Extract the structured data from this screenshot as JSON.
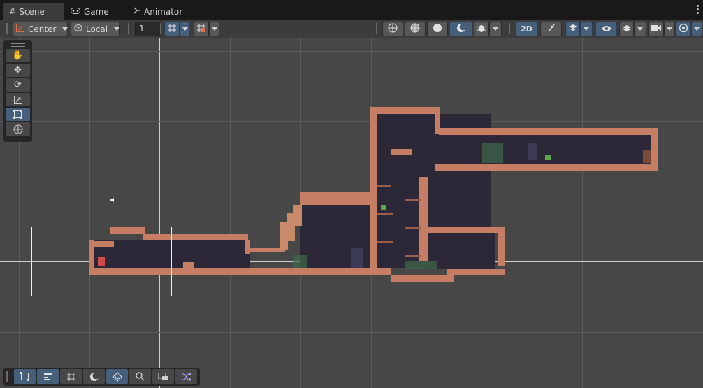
{
  "tabs": [
    {
      "label": "Scene",
      "icon": "grid-icon"
    },
    {
      "label": "Game",
      "icon": "gamepad-icon"
    },
    {
      "label": "Animator",
      "icon": "animator-icon"
    }
  ],
  "toolbar": {
    "pivot_mode": "Center",
    "pivot_rotation": "Local",
    "grid_size": "1",
    "mode_2d": "2D"
  },
  "icons": {
    "pivot": "pivot-icon",
    "local": "cube-icon",
    "snap": "grid-snap-icon",
    "increment": "increment-snap-icon",
    "wireframe": "wireframe-icon",
    "shaded_wire": "shaded-wireframe-icon",
    "shaded": "shaded-icon",
    "unlit": "unlit-icon",
    "debug": "bug-icon",
    "lighting": "lighting-toggle-icon",
    "effects": "effects-icon",
    "visibility": "eye-icon",
    "layers": "layers-icon",
    "camera": "camera-icon",
    "gizmos": "gizmos-icon",
    "audio": "audio-icon"
  },
  "tools": [
    "hand-tool",
    "move-tool",
    "rotate-tool",
    "scale-tool",
    "rect-tool",
    "transform-tool"
  ],
  "overlay_tools": [
    "rect-overlay",
    "tile-palette",
    "grid-overlay",
    "shading-overlay",
    "tilemap-overlay",
    "search-overlay",
    "camera-preview",
    "shuffle-overlay"
  ],
  "colors": {
    "accent": "#46607c",
    "scene_bg": "#474747",
    "brick": "#c57e63",
    "interior": "#2c2838"
  }
}
